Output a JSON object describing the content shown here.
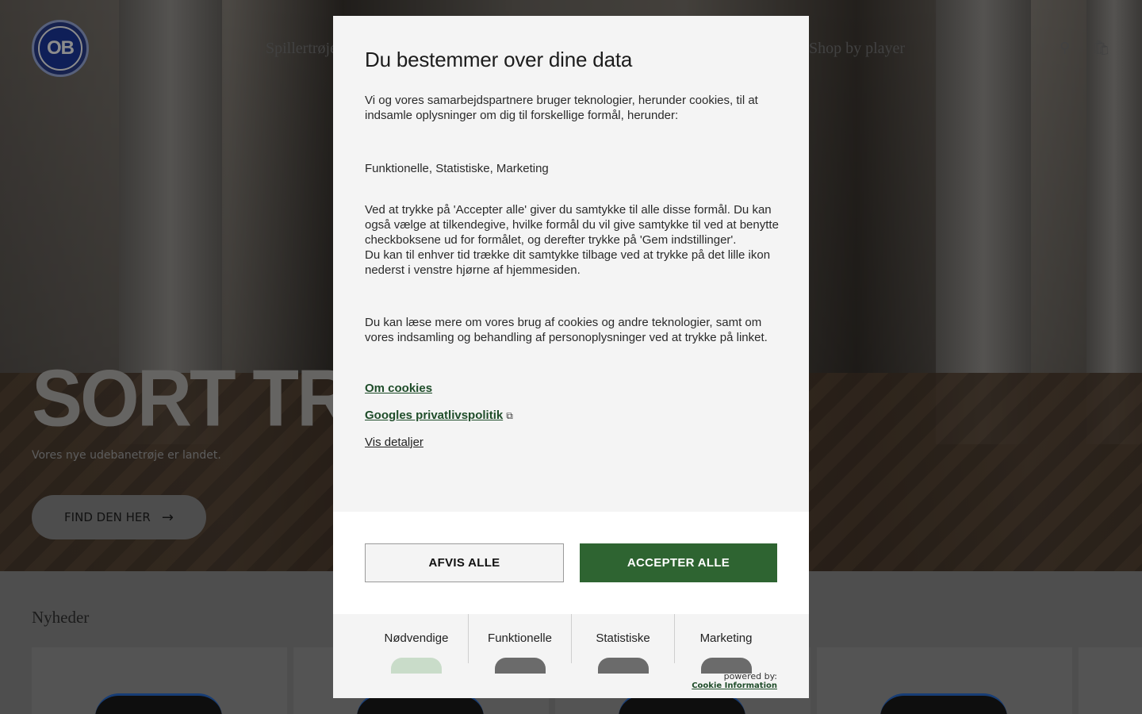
{
  "background_page": {
    "nav": {
      "item_left": "Spillertrøje",
      "item_right": "Shop by player"
    },
    "hero": {
      "title": "SORT TRØJE",
      "subtitle": "Vores nye udebanetrøje er landet.",
      "cta_label": "FIND DEN HER"
    },
    "section_title": "Nyheder",
    "logo_text": "OB"
  },
  "cookie_modal": {
    "title": "Du bestemmer over dine data",
    "intro": "Vi og vores samarbejdspartnere bruger teknologier, herunder cookies, til at indsamle oplysninger om dig til forskellige formål, herunder:",
    "purposes": "Funktionelle, Statistiske, Marketing",
    "consent_text_1": "Ved at trykke på 'Accepter alle' giver du samtykke til alle disse formål. Du kan også vælge at tilkendegive, hvilke formål du vil give samtykke til ved at benytte checkboksene ud for formålet, og derefter trykke på 'Gem indstillinger'.",
    "consent_text_2": "Du kan til enhver tid trække dit samtykke tilbage ved at trykke på det lille ikon nederst i venstre hjørne af hjemmesiden.",
    "read_more": "Du kan læse mere om vores brug af cookies og andre teknologier, samt om vores indsamling og behandling af personoplysninger ved at trykke på linket.",
    "link_cookies": "Om cookies",
    "link_google": "Googles privatlivspolitik",
    "link_details": "Vis detaljer",
    "btn_reject": "AFVIS ALLE",
    "btn_accept": "ACCEPTER ALLE",
    "categories": [
      {
        "label": "Nødvendige",
        "enabled": true
      },
      {
        "label": "Funktionelle",
        "enabled": false
      },
      {
        "label": "Statistiske",
        "enabled": false
      },
      {
        "label": "Marketing",
        "enabled": false
      }
    ],
    "powered_label": "powered by:",
    "powered_brand": "Cookie Information"
  },
  "colors": {
    "accept_green": "#2e6431",
    "link_green": "#1f4d2a",
    "modal_bg": "#f4f4f4"
  }
}
